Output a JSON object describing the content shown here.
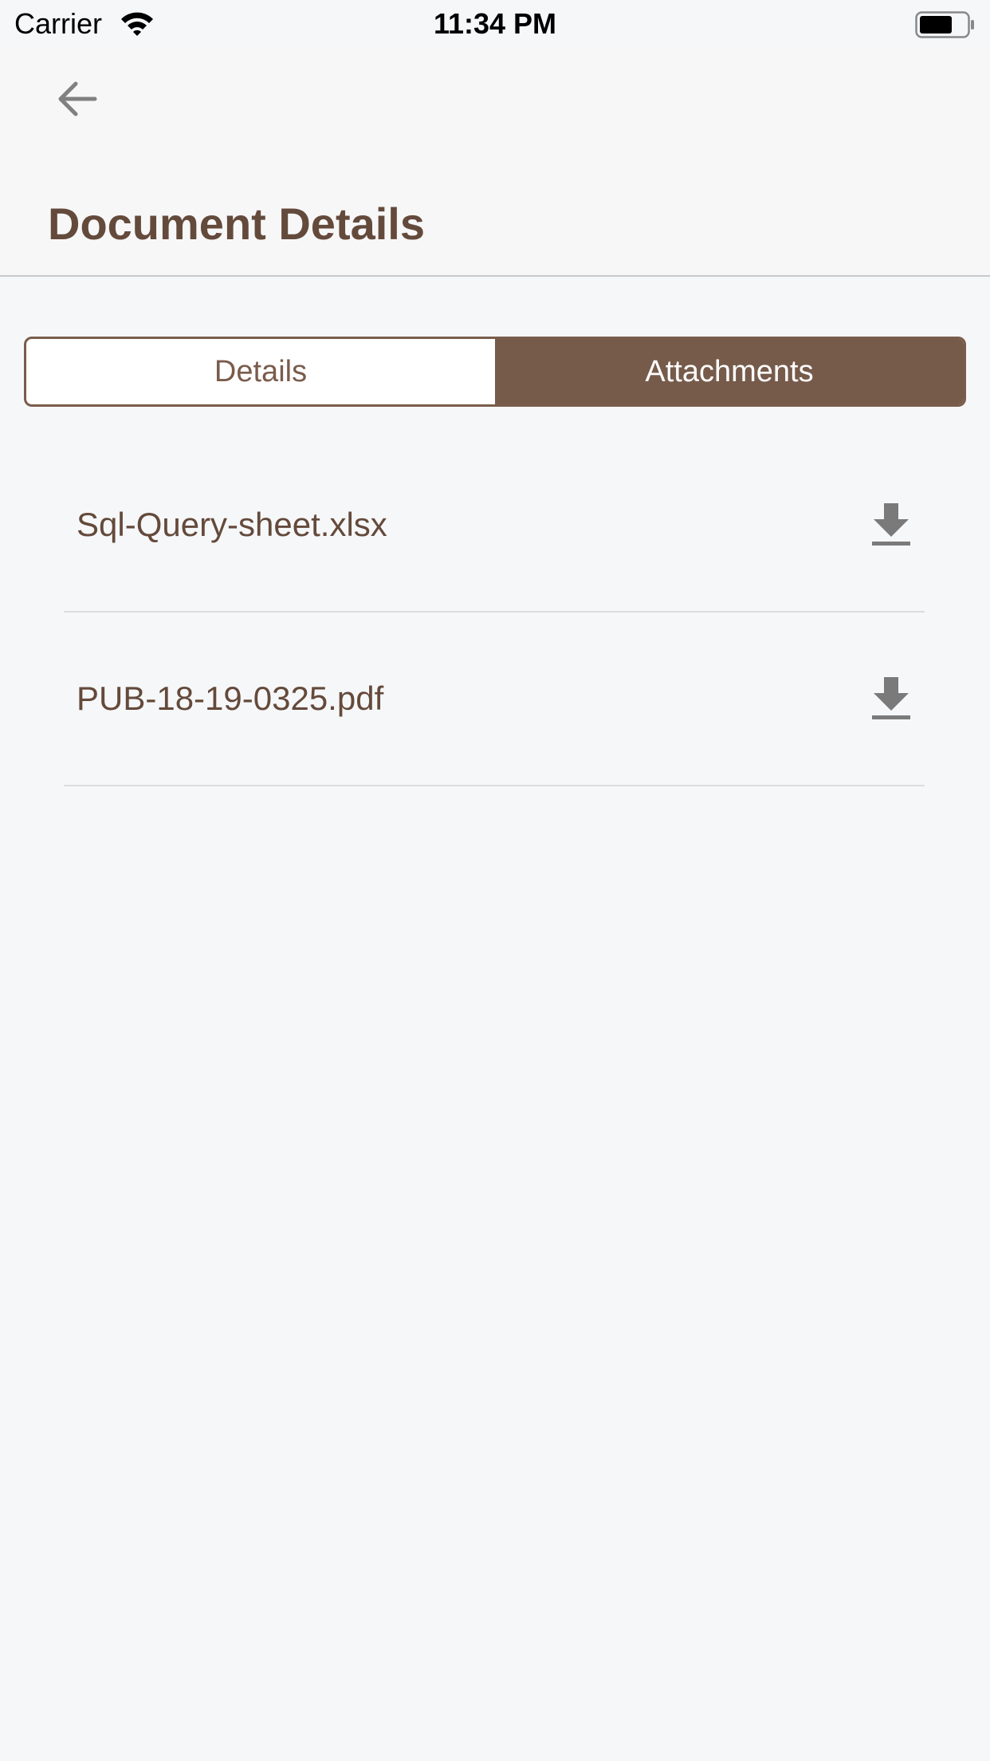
{
  "status_bar": {
    "carrier": "Carrier",
    "time": "11:34 PM",
    "wifi_icon": "wifi-icon",
    "battery_icon": "battery-icon"
  },
  "nav": {
    "back_icon": "arrow-left-icon",
    "title": "Document Details"
  },
  "tabs": [
    {
      "label": "Details",
      "active": false
    },
    {
      "label": "Attachments",
      "active": true
    }
  ],
  "attachments": [
    {
      "name": "Sql-Query-sheet.xlsx",
      "icon": "download-icon"
    },
    {
      "name": "PUB-18-19-0325.pdf",
      "icon": "download-icon"
    }
  ],
  "colors": {
    "accent": "#765b4b",
    "title_text": "#644a3b",
    "icon_gray": "#7a7a7a",
    "background": "#f6f7f9"
  }
}
